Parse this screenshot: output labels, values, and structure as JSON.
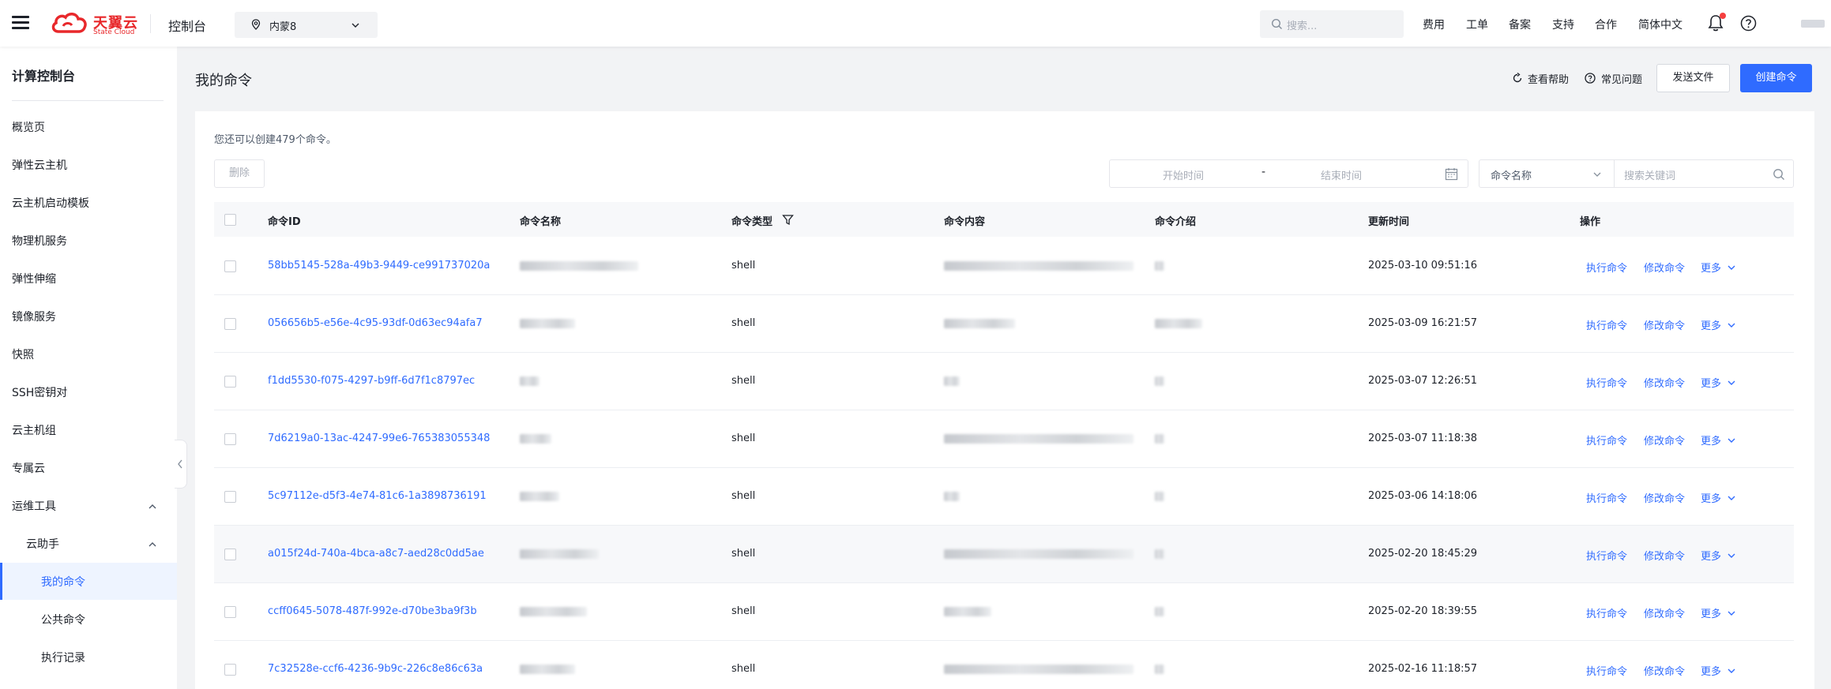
{
  "header": {
    "logo_cn": "天翼云",
    "logo_en": "State Cloud",
    "console": "控制台",
    "region": "内蒙8",
    "search_placeholder": "搜索...",
    "nav": [
      "费用",
      "工单",
      "备案",
      "支持",
      "合作",
      "简体中文"
    ],
    "colors": {
      "brand": "#e8282b",
      "accent": "#2f6bff",
      "notification": "#f53f3f"
    }
  },
  "sidebar": {
    "title": "计算控制台",
    "items": [
      "概览页",
      "弹性云主机",
      "云主机启动模板",
      "物理机服务",
      "弹性伸缩",
      "镜像服务",
      "快照",
      "SSH密钥对",
      "云主机组",
      "专属云"
    ],
    "ops_group": "运维工具",
    "assistant": "云助手",
    "assistant_items": [
      "我的命令",
      "公共命令",
      "执行记录"
    ],
    "active": "我的命令"
  },
  "page": {
    "title": "我的命令",
    "help_link": "查看帮助",
    "faq_link": "常见问题",
    "send_file": "发送文件",
    "create": "创建命令",
    "quota_text": "您还可以创建479个命令。",
    "delete": "删除",
    "start_time": "开始时间",
    "dash": "-",
    "end_time": "结束时间",
    "filter_select": "命令名称",
    "keyword_placeholder": "搜索关键词"
  },
  "table": {
    "columns": [
      "命令ID",
      "命令名称",
      "命令类型",
      "命令内容",
      "命令介绍",
      "更新时间",
      "操作"
    ],
    "actions": [
      "执行命令",
      "修改命令",
      "更多"
    ],
    "rows": [
      {
        "id": "58bb5145-528a-49b3-9449-ce991737020a",
        "type": "shell",
        "updated": "2025-03-10 09:51:16"
      },
      {
        "id": "056656b5-e56e-4c95-93df-0d63ec94afa7",
        "type": "shell",
        "updated": "2025-03-09 16:21:57"
      },
      {
        "id": "f1dd5530-f075-4297-b9ff-6d7f1c8797ec",
        "type": "shell",
        "updated": "2025-03-07 12:26:51"
      },
      {
        "id": "7d6219a0-13ac-4247-99e6-765383055348",
        "type": "shell",
        "updated": "2025-03-07 11:18:38"
      },
      {
        "id": "5c97112e-d5f3-4e74-81c6-1a3898736191",
        "type": "shell",
        "updated": "2025-03-06 14:18:06"
      },
      {
        "id": "a015f24d-740a-4bca-a8c7-aed28c0dd5ae",
        "type": "shell",
        "updated": "2025-02-20 18:45:29"
      },
      {
        "id": "ccff0645-5078-487f-992e-d70be3ba9f3b",
        "type": "shell",
        "updated": "2025-02-20 18:39:55"
      },
      {
        "id": "7c32528e-ccf6-4236-9b9c-226c8e86c63a",
        "type": "shell",
        "updated": "2025-02-16 11:18:57"
      }
    ]
  }
}
